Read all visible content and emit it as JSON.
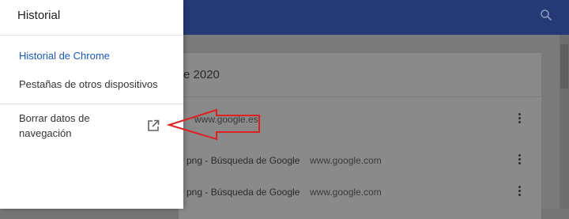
{
  "drawer": {
    "title": "Historial",
    "items": [
      {
        "label": "Historial de Chrome",
        "active": true
      },
      {
        "label": "Pestañas de otros dispositivos",
        "active": false
      }
    ],
    "clear_data": {
      "line1": "Borrar datos de",
      "line2": "navegación",
      "icon": "open-in-new-icon"
    }
  },
  "background": {
    "card_title": "e 2020",
    "rows": [
      {
        "title": "",
        "url": "www.google.es"
      },
      {
        "title": "0 png - Búsqueda de Google",
        "url": "www.google.com"
      },
      {
        "title": "0 png - Búsqueda de Google",
        "url": "www.google.com"
      }
    ]
  },
  "colors": {
    "app_bar": "#243a76",
    "active_link": "#1a56c6",
    "annotation_arrow": "#e02020"
  }
}
